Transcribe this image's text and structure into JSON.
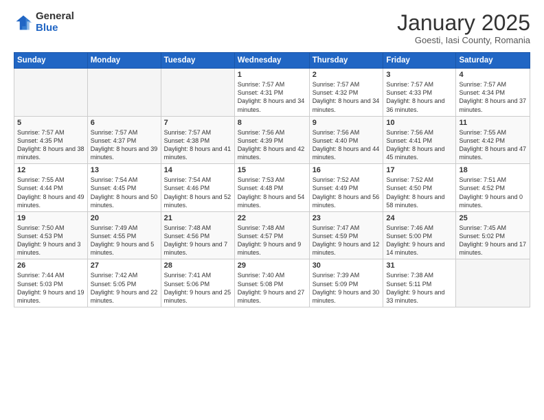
{
  "logo": {
    "general": "General",
    "blue": "Blue"
  },
  "header": {
    "month": "January 2025",
    "location": "Goesti, Iasi County, Romania"
  },
  "days_of_week": [
    "Sunday",
    "Monday",
    "Tuesday",
    "Wednesday",
    "Thursday",
    "Friday",
    "Saturday"
  ],
  "weeks": [
    [
      {
        "day": "",
        "info": ""
      },
      {
        "day": "",
        "info": ""
      },
      {
        "day": "",
        "info": ""
      },
      {
        "day": "1",
        "info": "Sunrise: 7:57 AM\nSunset: 4:31 PM\nDaylight: 8 hours\nand 34 minutes."
      },
      {
        "day": "2",
        "info": "Sunrise: 7:57 AM\nSunset: 4:32 PM\nDaylight: 8 hours\nand 34 minutes."
      },
      {
        "day": "3",
        "info": "Sunrise: 7:57 AM\nSunset: 4:33 PM\nDaylight: 8 hours\nand 36 minutes."
      },
      {
        "day": "4",
        "info": "Sunrise: 7:57 AM\nSunset: 4:34 PM\nDaylight: 8 hours\nand 37 minutes."
      }
    ],
    [
      {
        "day": "5",
        "info": "Sunrise: 7:57 AM\nSunset: 4:35 PM\nDaylight: 8 hours\nand 38 minutes."
      },
      {
        "day": "6",
        "info": "Sunrise: 7:57 AM\nSunset: 4:37 PM\nDaylight: 8 hours\nand 39 minutes."
      },
      {
        "day": "7",
        "info": "Sunrise: 7:57 AM\nSunset: 4:38 PM\nDaylight: 8 hours\nand 41 minutes."
      },
      {
        "day": "8",
        "info": "Sunrise: 7:56 AM\nSunset: 4:39 PM\nDaylight: 8 hours\nand 42 minutes."
      },
      {
        "day": "9",
        "info": "Sunrise: 7:56 AM\nSunset: 4:40 PM\nDaylight: 8 hours\nand 44 minutes."
      },
      {
        "day": "10",
        "info": "Sunrise: 7:56 AM\nSunset: 4:41 PM\nDaylight: 8 hours\nand 45 minutes."
      },
      {
        "day": "11",
        "info": "Sunrise: 7:55 AM\nSunset: 4:42 PM\nDaylight: 8 hours\nand 47 minutes."
      }
    ],
    [
      {
        "day": "12",
        "info": "Sunrise: 7:55 AM\nSunset: 4:44 PM\nDaylight: 8 hours\nand 49 minutes."
      },
      {
        "day": "13",
        "info": "Sunrise: 7:54 AM\nSunset: 4:45 PM\nDaylight: 8 hours\nand 50 minutes."
      },
      {
        "day": "14",
        "info": "Sunrise: 7:54 AM\nSunset: 4:46 PM\nDaylight: 8 hours\nand 52 minutes."
      },
      {
        "day": "15",
        "info": "Sunrise: 7:53 AM\nSunset: 4:48 PM\nDaylight: 8 hours\nand 54 minutes."
      },
      {
        "day": "16",
        "info": "Sunrise: 7:52 AM\nSunset: 4:49 PM\nDaylight: 8 hours\nand 56 minutes."
      },
      {
        "day": "17",
        "info": "Sunrise: 7:52 AM\nSunset: 4:50 PM\nDaylight: 8 hours\nand 58 minutes."
      },
      {
        "day": "18",
        "info": "Sunrise: 7:51 AM\nSunset: 4:52 PM\nDaylight: 9 hours\nand 0 minutes."
      }
    ],
    [
      {
        "day": "19",
        "info": "Sunrise: 7:50 AM\nSunset: 4:53 PM\nDaylight: 9 hours\nand 3 minutes."
      },
      {
        "day": "20",
        "info": "Sunrise: 7:49 AM\nSunset: 4:55 PM\nDaylight: 9 hours\nand 5 minutes."
      },
      {
        "day": "21",
        "info": "Sunrise: 7:48 AM\nSunset: 4:56 PM\nDaylight: 9 hours\nand 7 minutes."
      },
      {
        "day": "22",
        "info": "Sunrise: 7:48 AM\nSunset: 4:57 PM\nDaylight: 9 hours\nand 9 minutes."
      },
      {
        "day": "23",
        "info": "Sunrise: 7:47 AM\nSunset: 4:59 PM\nDaylight: 9 hours\nand 12 minutes."
      },
      {
        "day": "24",
        "info": "Sunrise: 7:46 AM\nSunset: 5:00 PM\nDaylight: 9 hours\nand 14 minutes."
      },
      {
        "day": "25",
        "info": "Sunrise: 7:45 AM\nSunset: 5:02 PM\nDaylight: 9 hours\nand 17 minutes."
      }
    ],
    [
      {
        "day": "26",
        "info": "Sunrise: 7:44 AM\nSunset: 5:03 PM\nDaylight: 9 hours\nand 19 minutes."
      },
      {
        "day": "27",
        "info": "Sunrise: 7:42 AM\nSunset: 5:05 PM\nDaylight: 9 hours\nand 22 minutes."
      },
      {
        "day": "28",
        "info": "Sunrise: 7:41 AM\nSunset: 5:06 PM\nDaylight: 9 hours\nand 25 minutes."
      },
      {
        "day": "29",
        "info": "Sunrise: 7:40 AM\nSunset: 5:08 PM\nDaylight: 9 hours\nand 27 minutes."
      },
      {
        "day": "30",
        "info": "Sunrise: 7:39 AM\nSunset: 5:09 PM\nDaylight: 9 hours\nand 30 minutes."
      },
      {
        "day": "31",
        "info": "Sunrise: 7:38 AM\nSunset: 5:11 PM\nDaylight: 9 hours\nand 33 minutes."
      },
      {
        "day": "",
        "info": ""
      }
    ]
  ]
}
